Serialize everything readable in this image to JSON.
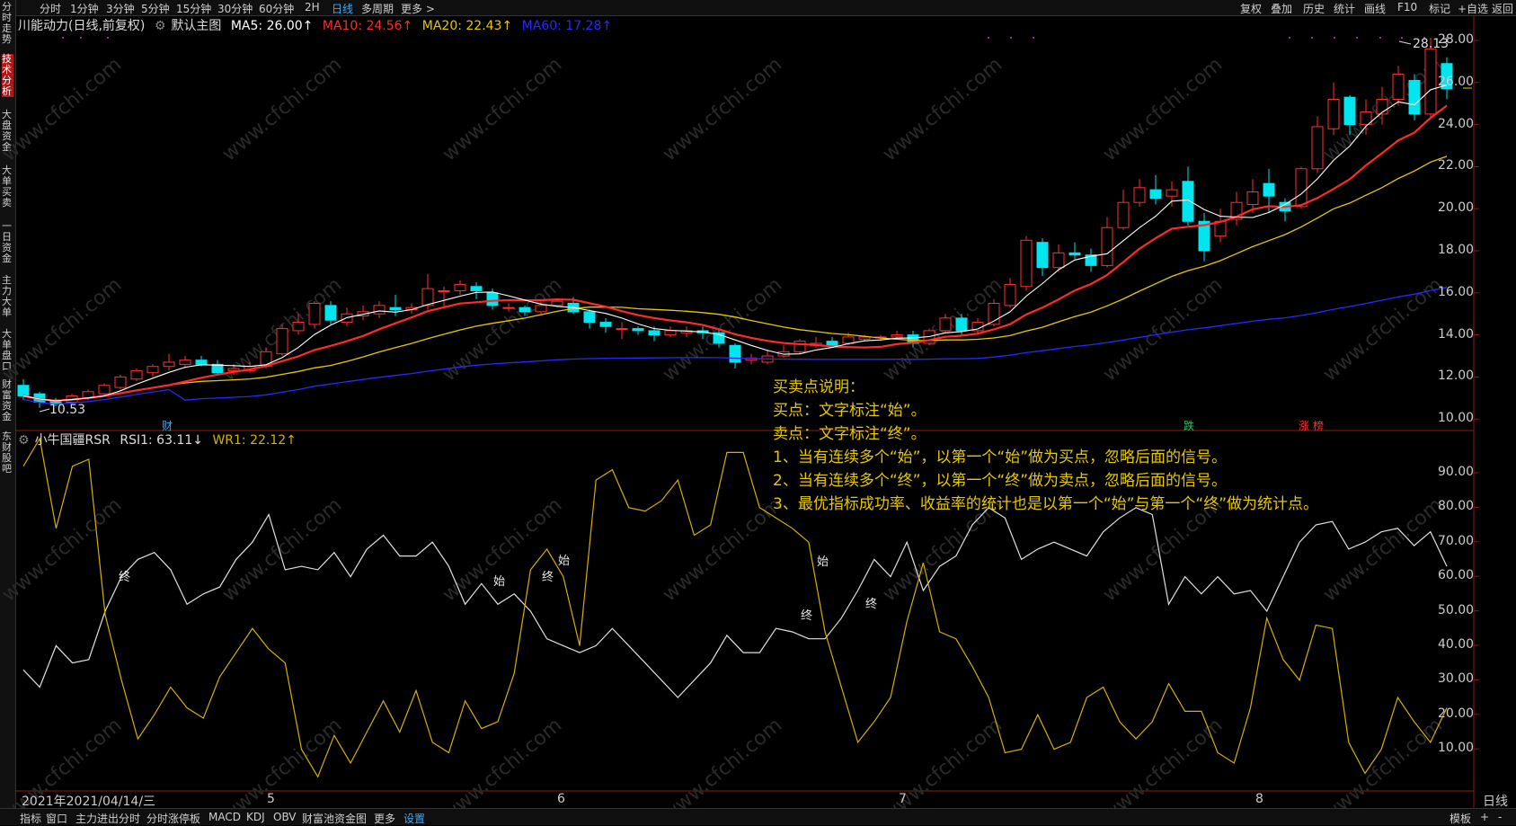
{
  "top_tabs": [
    "分时",
    "1分钟",
    "3分钟",
    "5分钟",
    "15分钟",
    "30分钟",
    "60分钟",
    "2H",
    "日线",
    "多周期",
    "更多 >"
  ],
  "top_active": "日线",
  "right_tabs": [
    "复权",
    "叠加",
    "历史",
    "统计",
    "画线",
    "F10",
    "+自选",
    "返回"
  ],
  "right_tag": "标记",
  "left_nav": [
    {
      "label": "分时走势",
      "active": false
    },
    {
      "label": "技术分析",
      "active": true
    },
    {
      "label": "大盘资金",
      "active": false
    },
    {
      "label": "大单买卖",
      "active": false
    },
    {
      "label": "一日资金",
      "active": false
    },
    {
      "label": "主力大单",
      "active": false
    },
    {
      "label": "大单盘口",
      "active": false
    },
    {
      "label": "财富资金",
      "active": false
    },
    {
      "label": "东财股吧",
      "active": false
    }
  ],
  "main_header": {
    "title": "川能动力(日线,前复权)",
    "preset": "默认主图",
    "ma5": "MA5: 26.00↑",
    "ma10": "MA10: 24.56↑",
    "ma20": "MA20: 22.43↑",
    "ma60": "MA60: 17.28↑",
    "colors": {
      "ma5": "#ffffff",
      "ma10": "#ff2a2a",
      "ma20": "#e6c800",
      "ma60": "#2828ff"
    }
  },
  "indicator_header": {
    "name": "小牛国疆RSR",
    "rsi1": "RSI1: 63.11↓",
    "wr1": "WR1: 22.12↑"
  },
  "price_axis": [
    "28.00",
    "26.00",
    "24.00",
    "22.00",
    "20.00",
    "18.00",
    "16.00",
    "14.00",
    "12.00",
    "10.00"
  ],
  "ind_axis": [
    "90.00",
    "80.00",
    "70.00",
    "60.00",
    "50.00",
    "40.00",
    "30.00",
    "20.00",
    "10.00"
  ],
  "x_axis": {
    "first": "2021年2021/04/14/三",
    "ticks": [
      "5",
      "6",
      "7",
      "8"
    ]
  },
  "high_label": "28.13",
  "low_label": "10.53",
  "notes": [
    "买卖点说明：",
    "买点：文字标注“始”。",
    "卖点：文字标注“终”。",
    "1、当有连续多个“始”，以第一个“始”做为买点，忽略后面的信号。",
    "2、当有连续多个“终”，以第一个“终”做为卖点，忽略后面的信号。",
    "3、最优指标成功率、收益率的统计也是以第一个“始”与第一个“终”做为统计点。"
  ],
  "signals": {
    "start": "始",
    "end": "终"
  },
  "bottom_tabs": [
    "指标",
    "窗口",
    "主力进出分时",
    "分时涨停板",
    "MACD",
    "KDJ",
    "OBV",
    "财富池资金图",
    "更多",
    "设置"
  ],
  "bottom_active": "设置",
  "bottom_right": [
    "模板",
    "+",
    "-"
  ],
  "period_label": "日线",
  "tags": {
    "fin": "财",
    "fall": "跌",
    "rise": "涨",
    "hot": "榜"
  },
  "watermark": "www.cfchi.com",
  "colors": {
    "up": "#ff3030",
    "down": "#00e5ee",
    "bg": "#000000",
    "rsi": "#e0e0e0",
    "wr": "#d4b000"
  }
}
